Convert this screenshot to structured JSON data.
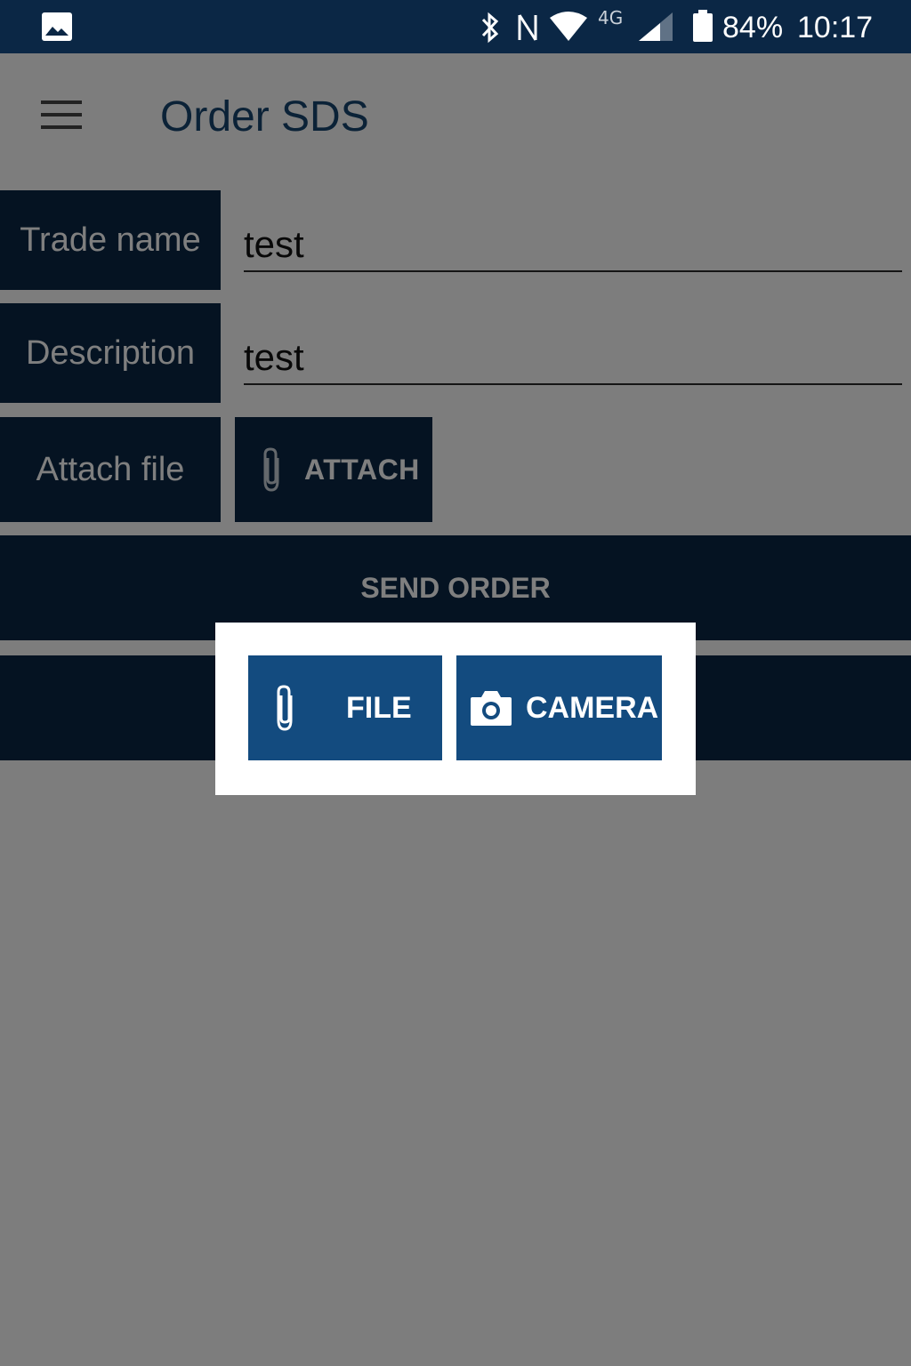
{
  "status_bar": {
    "network": "4G",
    "battery": "84%",
    "time": "10:17",
    "icons": [
      "gallery-icon",
      "bluetooth-icon",
      "nfc-icon",
      "wifi-icon",
      "signal-icon",
      "battery-icon"
    ]
  },
  "app_bar": {
    "title": "Order SDS",
    "menu_icon": "hamburger-menu-icon"
  },
  "form": {
    "trade_name": {
      "label": "Trade name",
      "value": "test"
    },
    "description": {
      "label": "Description",
      "value": "test"
    },
    "attach": {
      "label": "Attach file",
      "button_label": "ATTACH",
      "icon": "paperclip-icon"
    },
    "send_label": "SEND ORDER"
  },
  "dialog": {
    "file_label": "FILE",
    "file_icon": "paperclip-icon",
    "camera_label": "CAMERA",
    "camera_icon": "camera-icon"
  },
  "colors": {
    "primary_dark": "#0b2745",
    "primary": "#134b7f",
    "title": "#16446f",
    "scrim": "rgba(0,0,0,0.5)"
  }
}
